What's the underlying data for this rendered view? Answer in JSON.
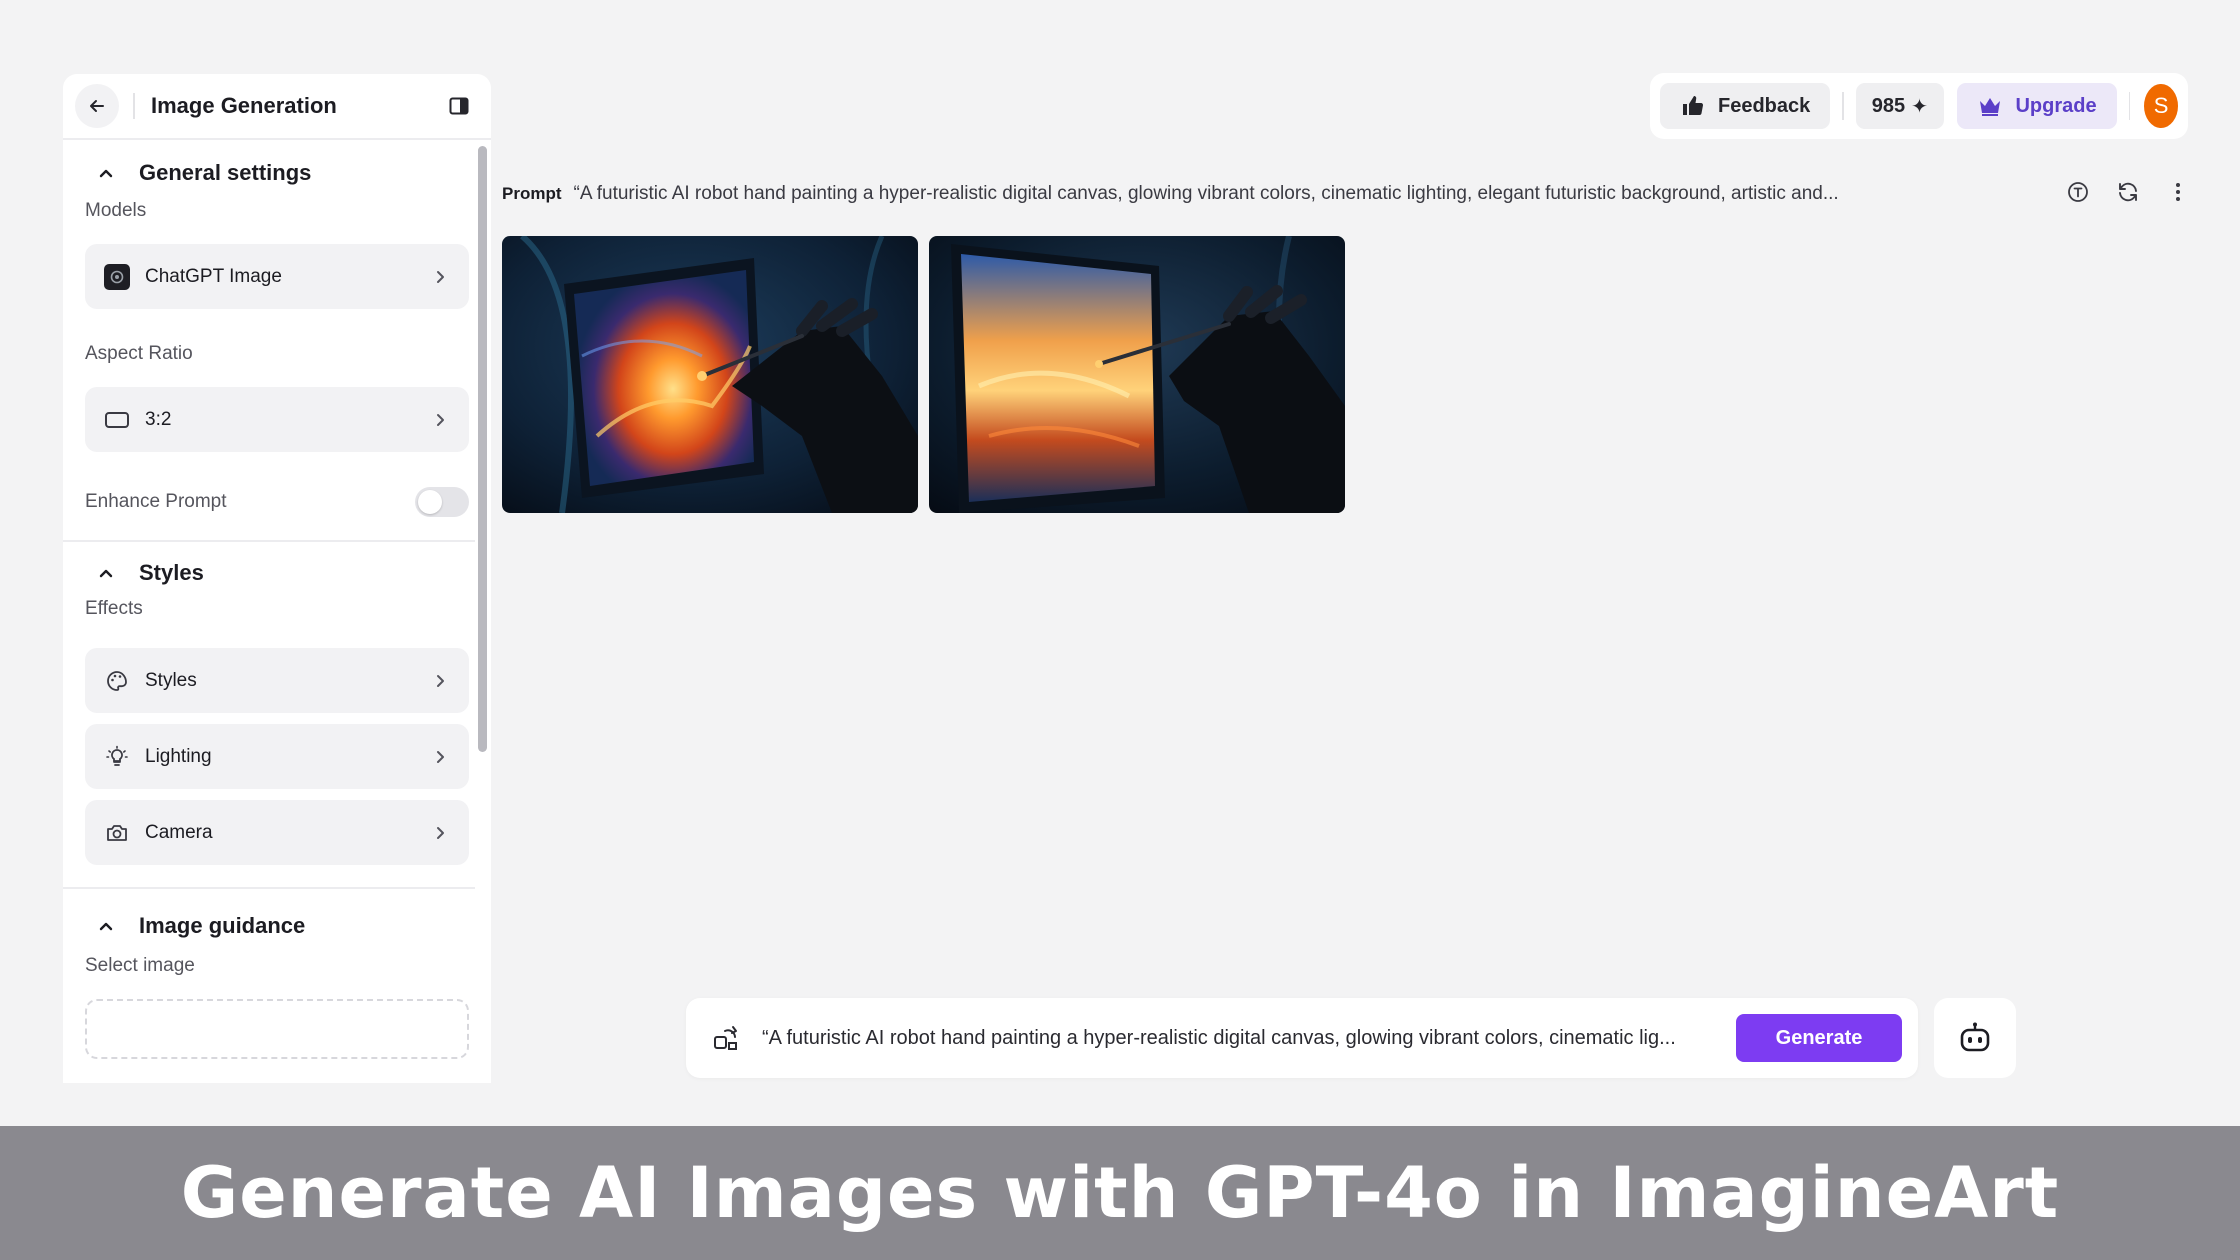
{
  "sidebar": {
    "title": "Image Generation",
    "sections": {
      "general": {
        "title": "General settings",
        "models_label": "Models",
        "model_value": "ChatGPT Image",
        "aspect_label": "Aspect Ratio",
        "aspect_value": "3:2",
        "enhance_label": "Enhance Prompt",
        "enhance_on": false
      },
      "styles": {
        "title": "Styles",
        "effects_label": "Effects",
        "items": [
          "Styles",
          "Lighting",
          "Camera"
        ]
      },
      "guidance": {
        "title": "Image guidance",
        "select_label": "Select image"
      }
    }
  },
  "topbar": {
    "feedback_label": "Feedback",
    "credits": "985",
    "upgrade_label": "Upgrade",
    "avatar_initial": "S"
  },
  "prompt": {
    "tag": "Prompt",
    "text": "“A futuristic AI robot hand painting a hyper-realistic digital canvas, glowing vibrant colors, cinematic lighting, elegant futuristic background, artistic and..."
  },
  "composer": {
    "text": "“A futuristic AI robot hand painting a hyper-realistic digital canvas, glowing vibrant colors, cinematic lig...",
    "generate_label": "Generate"
  },
  "caption": "Generate AI Images with GPT-4o in ImagineArt",
  "colors": {
    "accent": "#7d3cf2",
    "avatar": "#f06a00",
    "upgrade_text": "#5b3fc8"
  }
}
